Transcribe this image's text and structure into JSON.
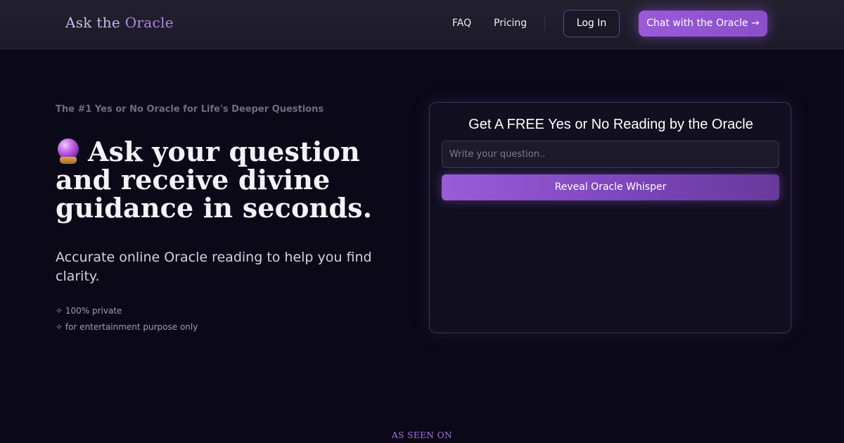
{
  "nav": {
    "logo_prefix": "Ask the",
    "logo_accent": "Oracle",
    "links": [
      {
        "label": "FAQ"
      },
      {
        "label": "Pricing"
      }
    ],
    "login_label": "Log In",
    "chat_label": "Chat with the Oracle →"
  },
  "hero": {
    "tagline": "The #1 Yes or No Oracle for Life's Deeper Questions",
    "headline_icon": "crystal-ball-icon",
    "headline": "Ask your question and receive divine guidance in seconds.",
    "subhead": "Accurate online Oracle reading to help you find clarity.",
    "features": [
      "✧ 100% private",
      "✧ for entertainment purpose only"
    ]
  },
  "card": {
    "title": "Get A FREE Yes or No Reading by the Oracle",
    "input_placeholder": "Write your question..",
    "input_value": "",
    "button_label": "Reveal Oracle Whisper"
  },
  "footer": {
    "seen_on": "AS SEEN ON"
  },
  "colors": {
    "background": "#0b0918",
    "accent": "#9b5ad9",
    "accent_text": "#b084e8"
  }
}
